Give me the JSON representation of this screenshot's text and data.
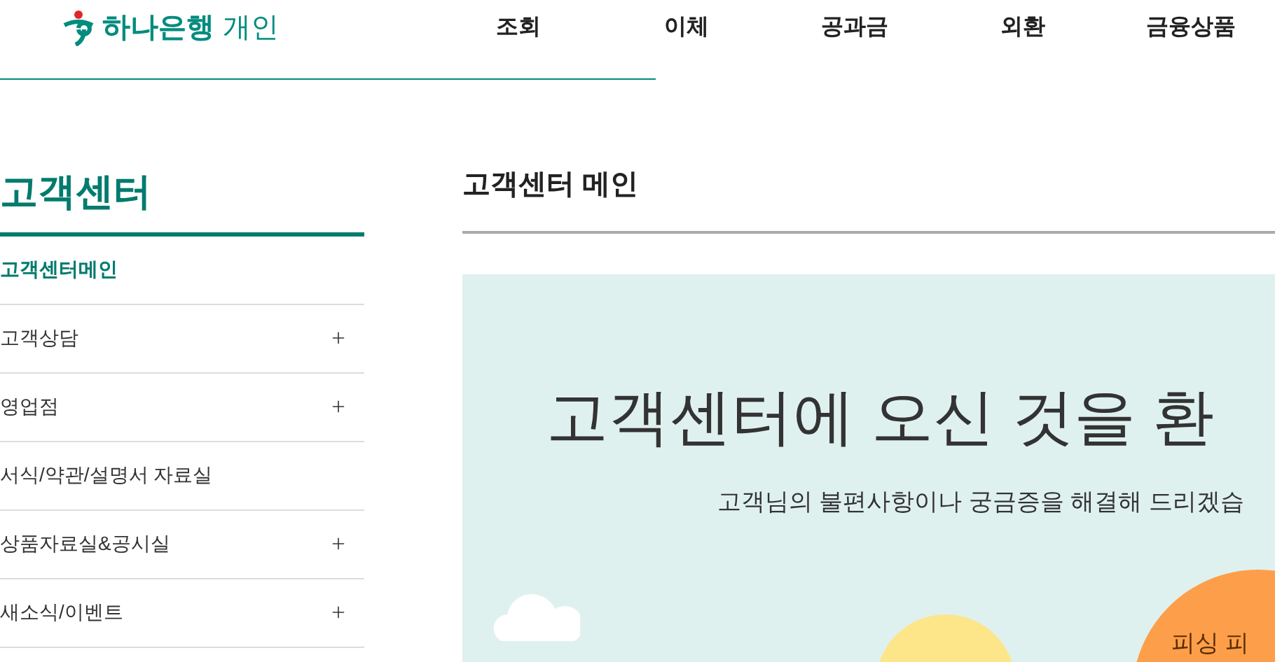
{
  "header": {
    "logo": "하나은행",
    "section": "개인",
    "nav": [
      {
        "label": "조회"
      },
      {
        "label": "이체"
      },
      {
        "label": "공과금"
      },
      {
        "label": "외환"
      },
      {
        "label": "금융상품"
      }
    ]
  },
  "sidebar": {
    "title": "고객센터",
    "items": [
      {
        "label": "고객센터메인",
        "selected": true,
        "expandable": false
      },
      {
        "label": "고객상담",
        "selected": false,
        "expandable": true
      },
      {
        "label": "영업점",
        "selected": false,
        "expandable": true
      },
      {
        "label": "서식/약관/설명서 자료실",
        "selected": false,
        "expandable": false
      },
      {
        "label": "상품자료실&공시실",
        "selected": false,
        "expandable": true
      },
      {
        "label": "새소식/이벤트",
        "selected": false,
        "expandable": true
      }
    ]
  },
  "main": {
    "title": "고객센터 메인",
    "banner": {
      "headline": "고객센터에 오신 것을 환",
      "subtitle": "고객님의 불편사항이나 궁금증을 해결해 드리겠습",
      "circle_text": "피싱 피"
    }
  }
}
